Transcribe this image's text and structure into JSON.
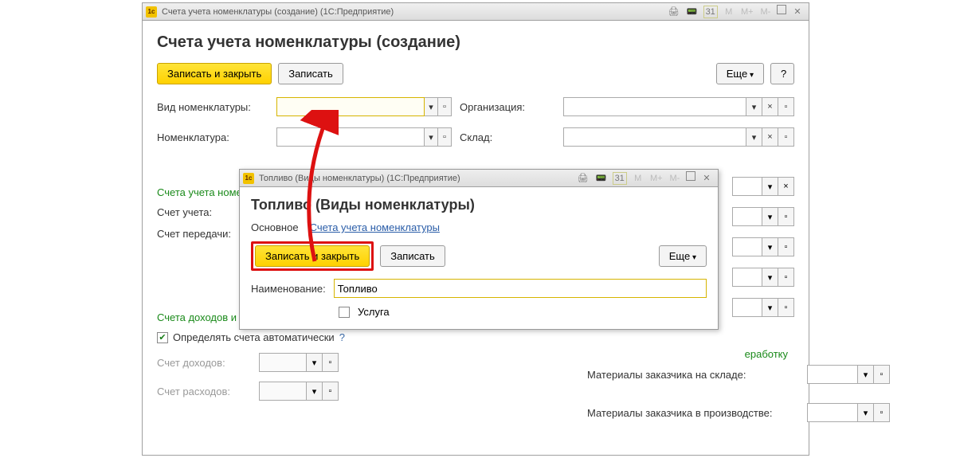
{
  "main_window": {
    "titlebar": "Счета учета номенклатуры (создание)  (1С:Предприятие)",
    "icons": {
      "print": "🖨",
      "calc": "📟",
      "calendar": "31",
      "m": "M",
      "mplus": "M+",
      "mminus": "M-",
      "minimize": "▁",
      "restore": "▢",
      "close": "✕"
    },
    "page_title": "Счета учета номенклатуры (создание)",
    "toolbar": {
      "save_close": "Записать и закрыть",
      "save": "Записать",
      "more": "Еще",
      "help": "?"
    },
    "fields": {
      "vid_label": "Вид номенклатуры:",
      "org_label": "Организация:",
      "nom_label": "Номенклатура:",
      "sklad_label": "Склад:"
    },
    "section_accounts": "Счета учета номенклатуры",
    "acc_label": "Счет учета:",
    "acc_transfer_label": "Счет передачи:",
    "section_income": "Счета доходов и расходов",
    "auto_check": "Определять счета автоматически",
    "income_label": "Счет доходов:",
    "expense_label": "Счет расходов:",
    "green_rhs": "еработку",
    "mat_sklad": "Материалы заказчика на складе:",
    "mat_proizv": "Материалы заказчика в производстве:"
  },
  "dialog": {
    "titlebar": "Топливо (Виды номенклатуры)  (1С:Предприятие)",
    "title": "Топливо (Виды номенклатуры)",
    "tab_main": "Основное",
    "tab_accounts": "Счета учета номенклатуры",
    "save_close": "Записать и закрыть",
    "save": "Записать",
    "more": "Еще",
    "name_label": "Наименование:",
    "name_value": "Топливо",
    "service_label": "Услуга"
  }
}
